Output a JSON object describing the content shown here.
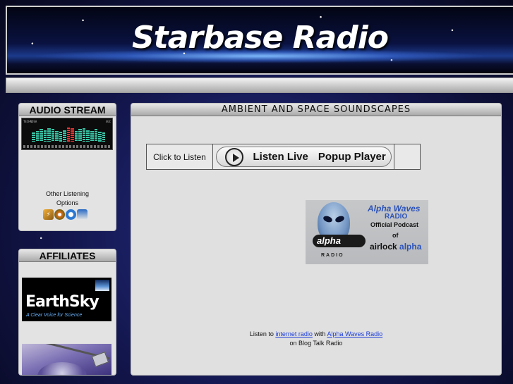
{
  "header": {
    "title": "Starbase Radio"
  },
  "audio_stream": {
    "heading": "AUDIO STREAM",
    "player_left": "TECHNOSA",
    "player_right": "4GC",
    "other_line1": "Other Listening",
    "other_line2": "Options",
    "icons": [
      "winamp-icon",
      "windows-media-icon",
      "quicktime-icon",
      "real-player-icon"
    ]
  },
  "affiliates": {
    "heading": "AFFILIATES",
    "earthsky_name": "EarthSky",
    "earthsky_tagline": "A Clear Voice for Science"
  },
  "main": {
    "heading": "AMBIENT AND SPACE SOUNDSCAPES",
    "click_to_listen": "Click to Listen",
    "listen_live": "Listen Live",
    "popup_player": "Popup Player",
    "alpha_banner": {
      "logo_text": "alpha",
      "small_radio": "RADIO",
      "title": "Alpha Waves",
      "radio": "RADIO",
      "official": "Official Podcast",
      "of": "of",
      "airlock": "airlock",
      "alpha": "alpha"
    },
    "footer": {
      "listen_to": "Listen to",
      "internet_radio": "internet radio",
      "with": "with",
      "alpha_waves_radio": "Alpha Waves Radio",
      "on_blog": "on Blog Talk Radio"
    }
  }
}
